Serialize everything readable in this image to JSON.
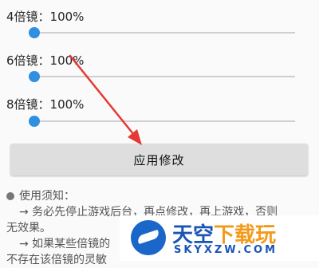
{
  "zoom_settings": [
    {
      "label": "4倍镜：100%",
      "percent": 0.02
    },
    {
      "label": "6倍镜：100%",
      "percent": 0.02
    },
    {
      "label": "8倍镜：100%",
      "percent": 0.02
    }
  ],
  "apply_button": {
    "label": "应用修改"
  },
  "notes": {
    "heading": "使用须知：",
    "lines": [
      "→ 务必先停止游戏后台，再点修改，再上游戏，否则",
      "无效果。",
      "→ 如果某些倍镜的",
      "不存在该倍镜的灵敏"
    ]
  },
  "watermark": {
    "title_main": "天空",
    "title_accent": "下载玩",
    "url": "SKYXZW.COM"
  },
  "colors": {
    "accent": "#2f8fe0",
    "button_bg": "#dedede",
    "arrow": "#e53935"
  }
}
